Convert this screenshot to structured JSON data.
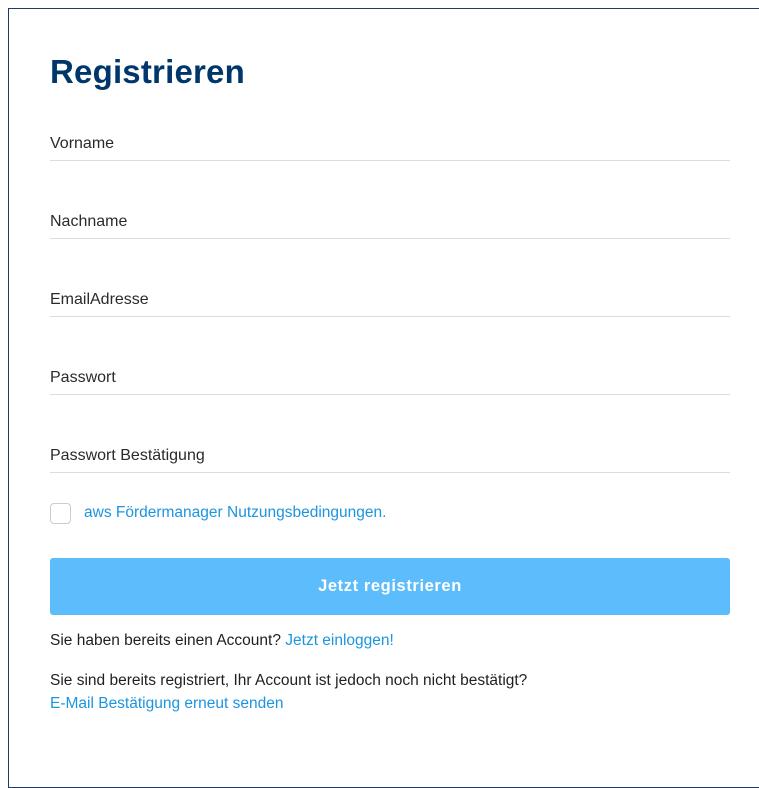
{
  "form": {
    "title": "Registrieren",
    "fields": {
      "firstname": {
        "placeholder": "Vorname",
        "value": ""
      },
      "lastname": {
        "placeholder": "Nachname",
        "value": ""
      },
      "email": {
        "placeholder": "EmailAdresse",
        "value": ""
      },
      "password": {
        "placeholder": "Passwort",
        "value": ""
      },
      "password_confirm": {
        "placeholder": "Passwort Bestätigung",
        "value": ""
      }
    },
    "terms": {
      "checked": false,
      "link_label": "aws Fördermanager Nutzungsbedingungen."
    },
    "submit_label": "Jetzt registrieren",
    "login_prompt": {
      "text": "Sie haben bereits einen Account?",
      "link_label": "Jetzt einloggen!"
    },
    "resend_prompt": {
      "text": "Sie sind bereits registriert, Ihr Account ist jedoch noch nicht bestätigt?",
      "link_label": "E-Mail Bestätigung erneut senden"
    }
  },
  "colors": {
    "title": "#00376b",
    "link": "#1b95e0",
    "button_bg": "#5cbcfc",
    "button_text": "#ffffff",
    "field_border": "#d9dde3",
    "panel_border": "#1e3a66"
  }
}
